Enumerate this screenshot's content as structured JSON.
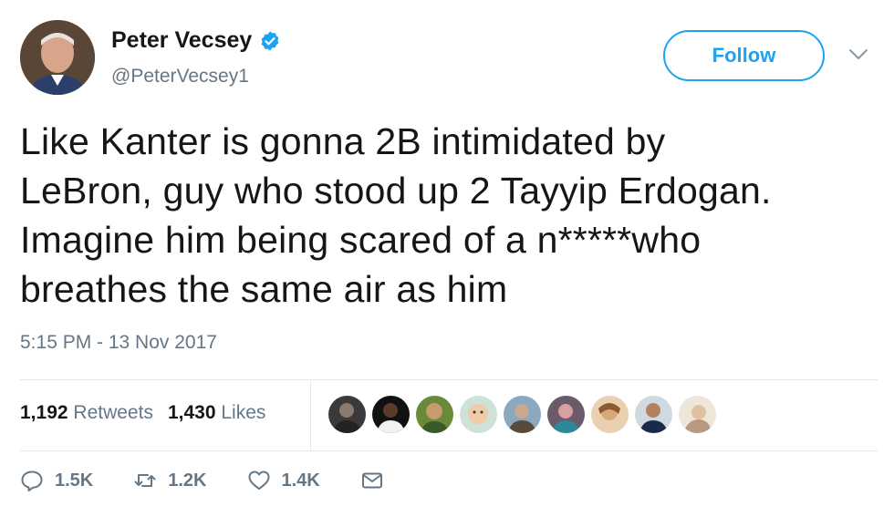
{
  "user": {
    "name": "Peter Vecsey",
    "handle": "@PeterVecsey1",
    "verified_icon": "verified-badge-icon"
  },
  "follow_label": "Follow",
  "tweet": {
    "lines": [
      "Like Kanter is gonna 2B intimidated by",
      "LeBron, guy who stood up 2 Tayyip Erdogan.",
      "Imagine him being scared of a n*****who",
      "breathes the same air as him"
    ],
    "timestamp": "5:15 PM - 13 Nov 2017"
  },
  "stats": {
    "retweets_count": "1,192",
    "retweets_label": "Retweets",
    "likes_count": "1,430",
    "likes_label": "Likes"
  },
  "liker_avatars": [
    "avatar-1",
    "avatar-2",
    "avatar-3",
    "avatar-4",
    "avatar-5",
    "avatar-6",
    "avatar-7",
    "avatar-8",
    "avatar-9"
  ],
  "actions": {
    "reply_count": "1.5K",
    "retweet_count": "1.2K",
    "like_count": "1.4K"
  },
  "colors": {
    "accent": "#1da1f2",
    "muted": "#657786",
    "text": "#14171a"
  }
}
